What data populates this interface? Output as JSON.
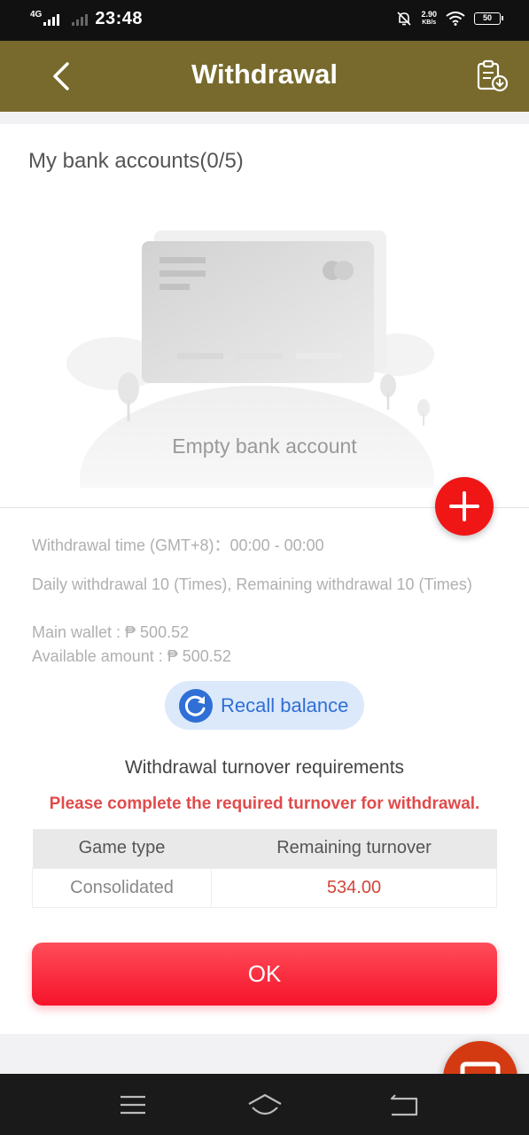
{
  "status_bar": {
    "network": "4G",
    "time": "23:48",
    "speed_value": "2.90",
    "speed_unit": "KB/s",
    "battery": "50"
  },
  "header": {
    "title": "Withdrawal",
    "back_icon": "chevron-left-icon",
    "record_icon": "clipboard-download-icon"
  },
  "bank": {
    "title": "My bank accounts(0/5)",
    "empty_text": "Empty bank account",
    "add_icon": "plus-icon"
  },
  "info": {
    "withdrawal_time": "Withdrawal time (GMT+8)：00:00 - 00:00",
    "daily": "Daily withdrawal 10 (Times), Remaining withdrawal 10 (Times)",
    "main_wallet": "Main wallet : ₱ 500.52",
    "available": "Available amount : ₱ 500.52"
  },
  "recall": {
    "label": "Recall balance",
    "icon": "refresh-icon"
  },
  "turnover": {
    "title": "Withdrawal turnover requirements",
    "warning": "Please complete the required turnover for withdrawal.",
    "headers": [
      "Game type",
      "Remaining turnover"
    ],
    "rows": [
      {
        "game_type": "Consolidated",
        "remaining": "534.00"
      }
    ]
  },
  "ok_label": "OK",
  "chat_icon": "chat-bubble-icon",
  "colors": {
    "header": "#776a2c",
    "accent_red": "#f01616",
    "ok_button": "#f5132a",
    "recall_blue": "#2f6fd6",
    "warning": "#e04b4b"
  }
}
